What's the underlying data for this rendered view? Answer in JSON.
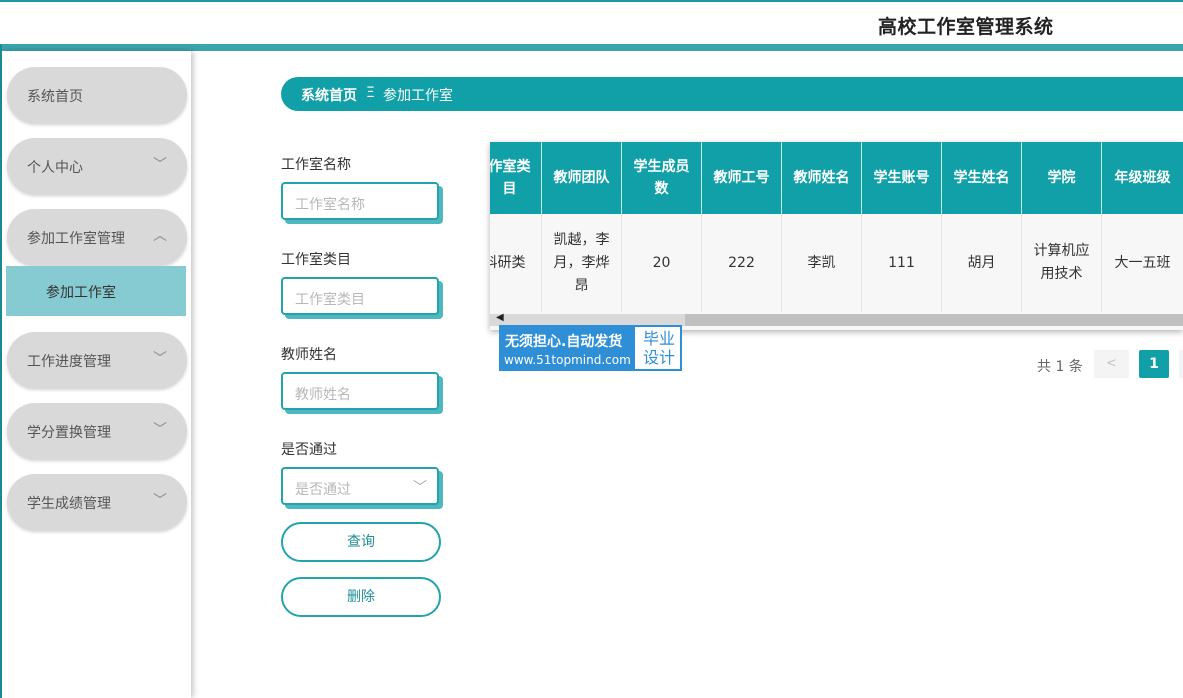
{
  "header": {
    "title": "高校工作室管理系统"
  },
  "sidebar": {
    "items": [
      {
        "label": "系统首页",
        "chevron": ""
      },
      {
        "label": "个人中心",
        "chevron": "﹀"
      },
      {
        "label": "参加工作室管理",
        "chevron": "︿"
      },
      {
        "label": "工作进度管理",
        "chevron": "﹀"
      },
      {
        "label": "学分置换管理",
        "chevron": "﹀"
      },
      {
        "label": "学生成绩管理",
        "chevron": "﹀"
      }
    ],
    "sub_item": {
      "label": "参加工作室"
    }
  },
  "breadcrumb": {
    "home": "系统首页",
    "separator": "Ξ",
    "current": "参加工作室"
  },
  "search": {
    "fields": [
      {
        "label": "工作室名称",
        "placeholder": "工作室名称"
      },
      {
        "label": "工作室类目",
        "placeholder": "工作室类目"
      },
      {
        "label": "教师姓名",
        "placeholder": "教师姓名"
      },
      {
        "label": "是否通过",
        "placeholder": "是否通过"
      }
    ],
    "query_label": "查询",
    "delete_label": "删除"
  },
  "table": {
    "headers": [
      "作室类目",
      "教师团队",
      "学生成员数",
      "教师工号",
      "教师姓名",
      "学生账号",
      "学生姓名",
      "学院",
      "年级班级"
    ],
    "row": [
      "科研类",
      "凯越，李月，李烨昂",
      "20",
      "222",
      "李凯",
      "111",
      "胡月",
      "计算机应用技术",
      "大一五班"
    ]
  },
  "watermark": {
    "line1": "无须担心.自动发货",
    "line2": "www.51topmind.com",
    "badge": "毕业设计"
  },
  "pagination": {
    "total": "共 1 条",
    "prev": "<",
    "current_page": "1"
  },
  "colors": {
    "primary": "#12a0a8",
    "menu_bg": "#d9d9d9",
    "active_sub": "#86cbd1",
    "watermark_blue": "#2f8fd6"
  }
}
